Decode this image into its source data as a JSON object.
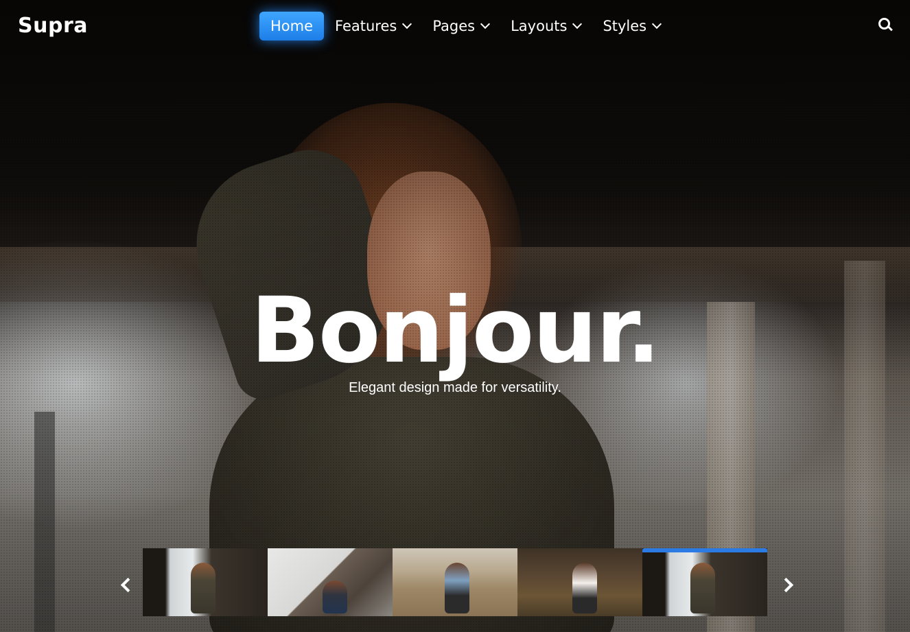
{
  "brand": "Supra",
  "nav": {
    "items": [
      {
        "label": "Home",
        "active": true,
        "dropdown": false
      },
      {
        "label": "Features",
        "active": false,
        "dropdown": true
      },
      {
        "label": "Pages",
        "active": false,
        "dropdown": true
      },
      {
        "label": "Layouts",
        "active": false,
        "dropdown": true
      },
      {
        "label": "Styles",
        "active": false,
        "dropdown": true
      }
    ],
    "search_icon": "search-icon"
  },
  "hero": {
    "title": "Bonjour.",
    "subtitle": "Elegant design made for versatility."
  },
  "carousel": {
    "prev_icon": "chevron-left-icon",
    "next_icon": "chevron-right-icon",
    "active_index": 4,
    "thumbnail_count": 5
  },
  "colors": {
    "accent": "#2c7be5",
    "active_nav": "#1d7ee8",
    "text": "#ffffff"
  }
}
